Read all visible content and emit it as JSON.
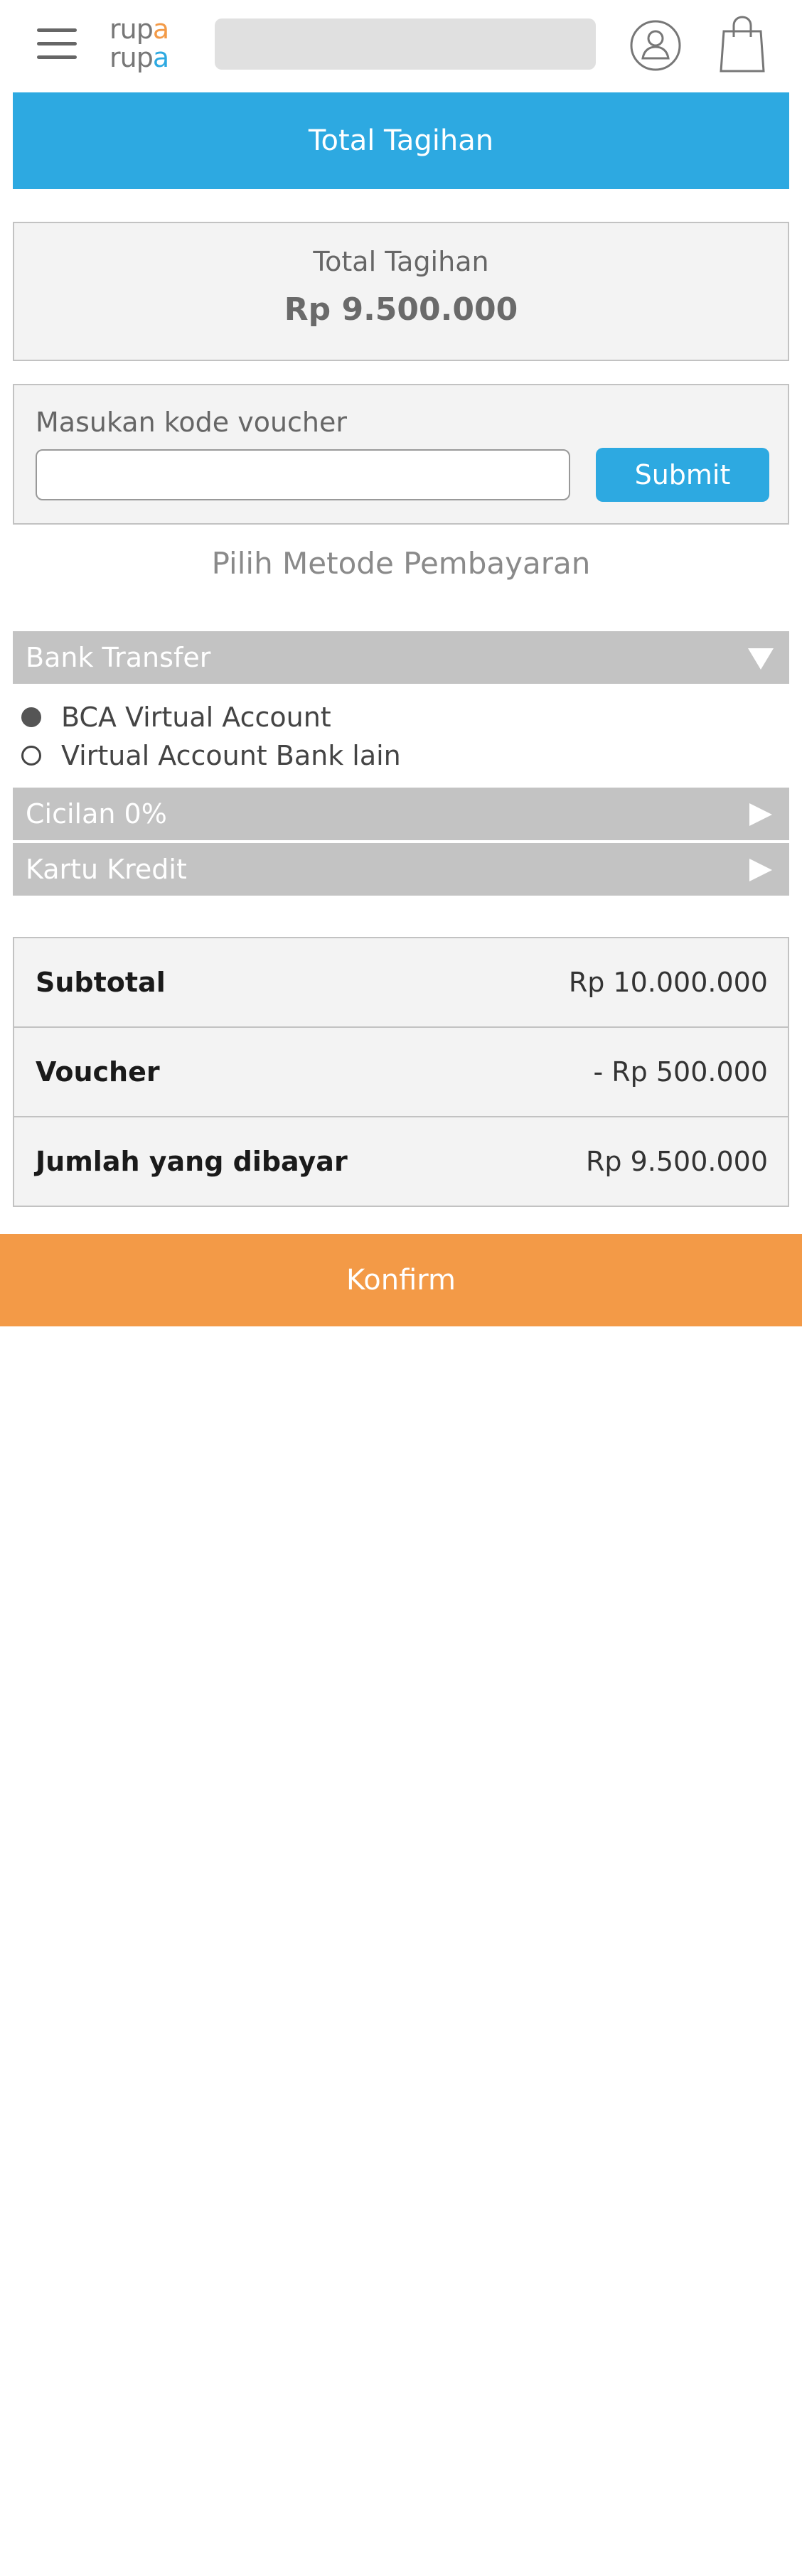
{
  "header": {
    "logo_line1_prefix": "rup",
    "logo_line1_accent": "a",
    "logo_line2_prefix": "rup",
    "logo_line2_accent": "a",
    "search_placeholder": "",
    "icons": [
      "menu-icon",
      "user-icon",
      "shopping-bag-icon"
    ]
  },
  "page_title": "Total Tagihan",
  "total": {
    "label": "Total Tagihan",
    "value": "Rp 9.500.000"
  },
  "voucher": {
    "label": "Masukan kode voucher",
    "input_value": "",
    "submit_label": "Submit"
  },
  "payment": {
    "title": "Pilih Metode Pembayaran",
    "methods": [
      {
        "label": "Bank Transfer",
        "expanded": true,
        "options": [
          {
            "label": "BCA Virtual Account",
            "selected": true
          },
          {
            "label": "Virtual Account Bank lain",
            "selected": false
          }
        ]
      },
      {
        "label": "Cicilan 0%",
        "expanded": false
      },
      {
        "label": "Kartu Kredit",
        "expanded": false
      }
    ]
  },
  "summary": [
    {
      "label": "Subtotal",
      "value": "Rp 10.000.000"
    },
    {
      "label": "Voucher",
      "value": "- Rp 500.000"
    },
    {
      "label": "Jumlah yang dibayar",
      "value": "Rp 9.500.000"
    }
  ],
  "confirm_label": "Konfirm",
  "colors": {
    "primary_blue": "#2da9e1",
    "accent_orange": "#f39a47",
    "accordion_gray": "#c3c3c3",
    "panel_bg": "#f3f3f3"
  }
}
